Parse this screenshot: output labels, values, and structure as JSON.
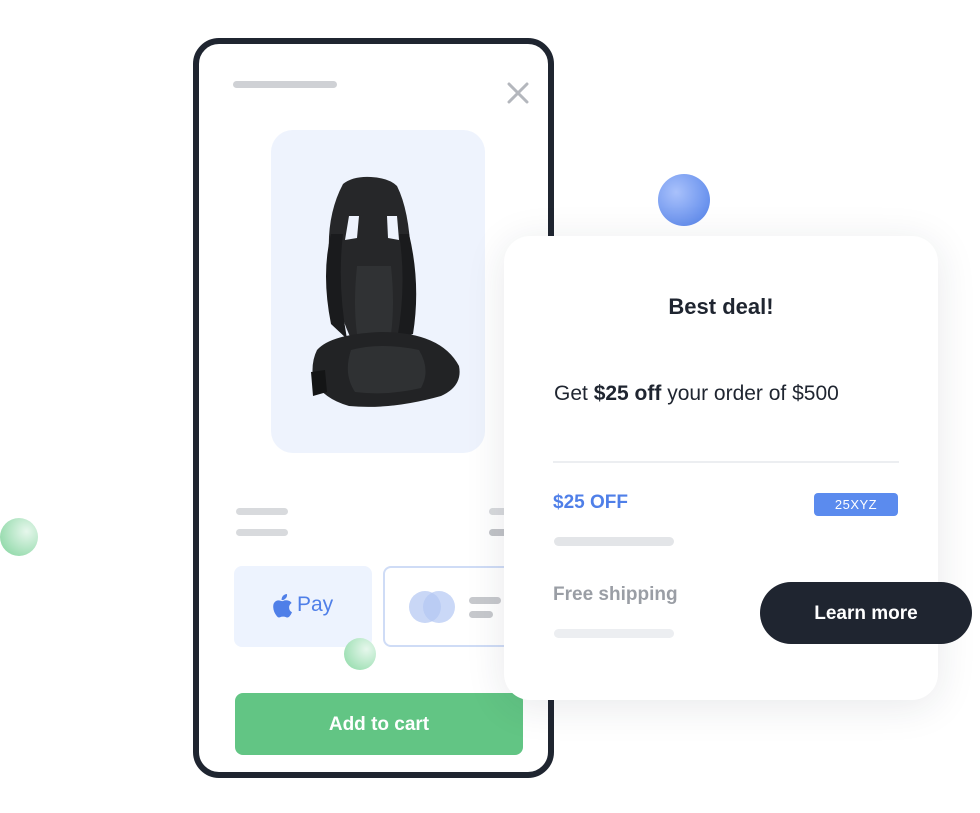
{
  "product": {
    "image_alt": "racing seat",
    "pay_options": {
      "apple_pay_label": "Pay"
    },
    "add_to_cart_label": "Add to cart"
  },
  "deal_card": {
    "title": "Best deal!",
    "offer_prefix": "Get ",
    "offer_amount": "$25 off",
    "offer_suffix": " your order of $500",
    "discount_label": "$25 OFF",
    "coupon_code": "25XYZ",
    "shipping_label": "Free shipping",
    "learn_more_label": "Learn more"
  },
  "icons": [
    "close-icon",
    "apple-icon",
    "card-icon"
  ],
  "colors": {
    "dark": "#1f2530",
    "accent_blue": "#4f7fe8",
    "add_to_cart_green": "#62c584",
    "product_bg": "#eef3fd"
  }
}
